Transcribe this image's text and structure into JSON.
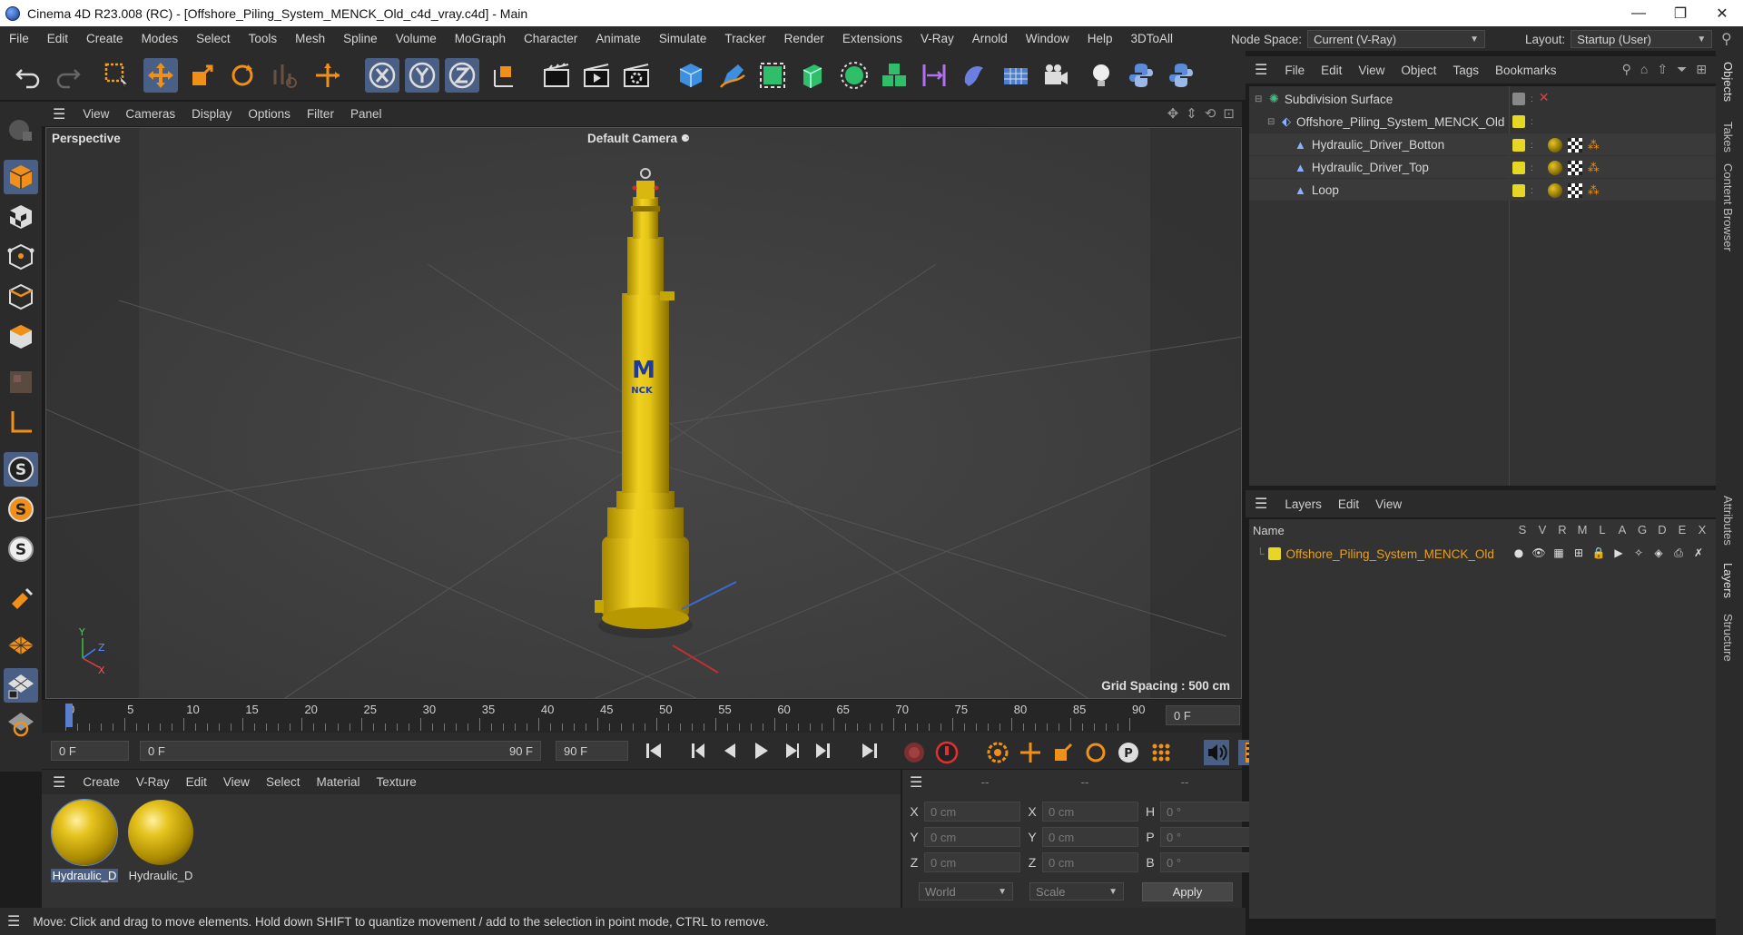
{
  "window": {
    "title": "Cinema 4D R23.008 (RC) - [Offshore_Piling_System_MENCK_Old_c4d_vray.c4d] - Main",
    "minimize": "—",
    "maximize": "❐",
    "close": "✕"
  },
  "menubar": {
    "items": [
      "File",
      "Edit",
      "Create",
      "Modes",
      "Select",
      "Tools",
      "Mesh",
      "Spline",
      "Volume",
      "MoGraph",
      "Character",
      "Animate",
      "Simulate",
      "Tracker",
      "Render",
      "Extensions",
      "V-Ray",
      "Arnold",
      "Window",
      "Help",
      "3DToAll"
    ],
    "node_space_label": "Node Space:",
    "node_space_value": "Current (V-Ray)",
    "layout_label": "Layout:",
    "layout_value": "Startup (User)"
  },
  "viewport": {
    "menu": [
      "View",
      "Cameras",
      "Display",
      "Options",
      "Filter",
      "Panel"
    ],
    "name": "Perspective",
    "camera": "Default Camera",
    "grid_spacing": "Grid Spacing : 500 cm",
    "logo_text": "M",
    "logo_sub": "NCK",
    "axis_y": "Y",
    "axis_z": "Z",
    "axis_x": "X"
  },
  "timeline": {
    "ticks": [
      "0",
      "5",
      "10",
      "15",
      "20",
      "25",
      "30",
      "35",
      "40",
      "45",
      "50",
      "55",
      "60",
      "65",
      "70",
      "75",
      "80",
      "85",
      "90"
    ],
    "current_frame": "0 F",
    "start_field": "0 F",
    "range_start": "0 F",
    "range_end": "90 F",
    "end_field": "90 F",
    "max_frames": 90
  },
  "material_manager": {
    "menu": [
      "Create",
      "V-Ray",
      "Edit",
      "View",
      "Select",
      "Material",
      "Texture"
    ],
    "materials": [
      {
        "label": "Hydraulic_D",
        "selected": true
      },
      {
        "label": "Hydraulic_D",
        "selected": false
      }
    ]
  },
  "coordinates": {
    "header": [
      "--",
      "--",
      "--"
    ],
    "rows": [
      {
        "l1": "X",
        "v1": "0 cm",
        "l2": "X",
        "v2": "0 cm",
        "l3": "H",
        "v3": "0 °"
      },
      {
        "l1": "Y",
        "v1": "0 cm",
        "l2": "Y",
        "v2": "0 cm",
        "l3": "P",
        "v3": "0 °"
      },
      {
        "l1": "Z",
        "v1": "0 cm",
        "l2": "Z",
        "v2": "0 cm",
        "l3": "B",
        "v3": "0 °"
      }
    ],
    "world": "World",
    "scale": "Scale",
    "apply": "Apply"
  },
  "status": {
    "text": "Move: Click and drag to move elements. Hold down SHIFT to quantize movement / add to the selection in point mode, CTRL to remove."
  },
  "object_manager": {
    "menu": [
      "File",
      "Edit",
      "View",
      "Object",
      "Tags",
      "Bookmarks"
    ],
    "objects": [
      {
        "name": "Subdivision Surface",
        "indent": 0
      },
      {
        "name": "Offshore_Piling_System_MENCK_Old",
        "indent": 1
      },
      {
        "name": "Hydraulic_Driver_Botton",
        "indent": 2
      },
      {
        "name": "Hydraulic_Driver_Top",
        "indent": 2
      },
      {
        "name": "Loop",
        "indent": 2
      }
    ]
  },
  "layer_manager": {
    "menu": [
      "Layers",
      "Edit",
      "View"
    ],
    "name_header": "Name",
    "flag_headers": [
      "S",
      "V",
      "R",
      "M",
      "L",
      "A",
      "G",
      "D",
      "E",
      "X"
    ],
    "layers": [
      {
        "name": "Offshore_Piling_System_MENCK_Old"
      }
    ]
  },
  "right_tabs": [
    "Objects",
    "Takes",
    "Content Browser",
    "Attributes",
    "Layers",
    "Structure"
  ],
  "colors": {
    "accent": "#4a5f85",
    "layer_name": "#e8a020",
    "swatch": "#e6d625",
    "model_yellow": "#e8c81a"
  }
}
